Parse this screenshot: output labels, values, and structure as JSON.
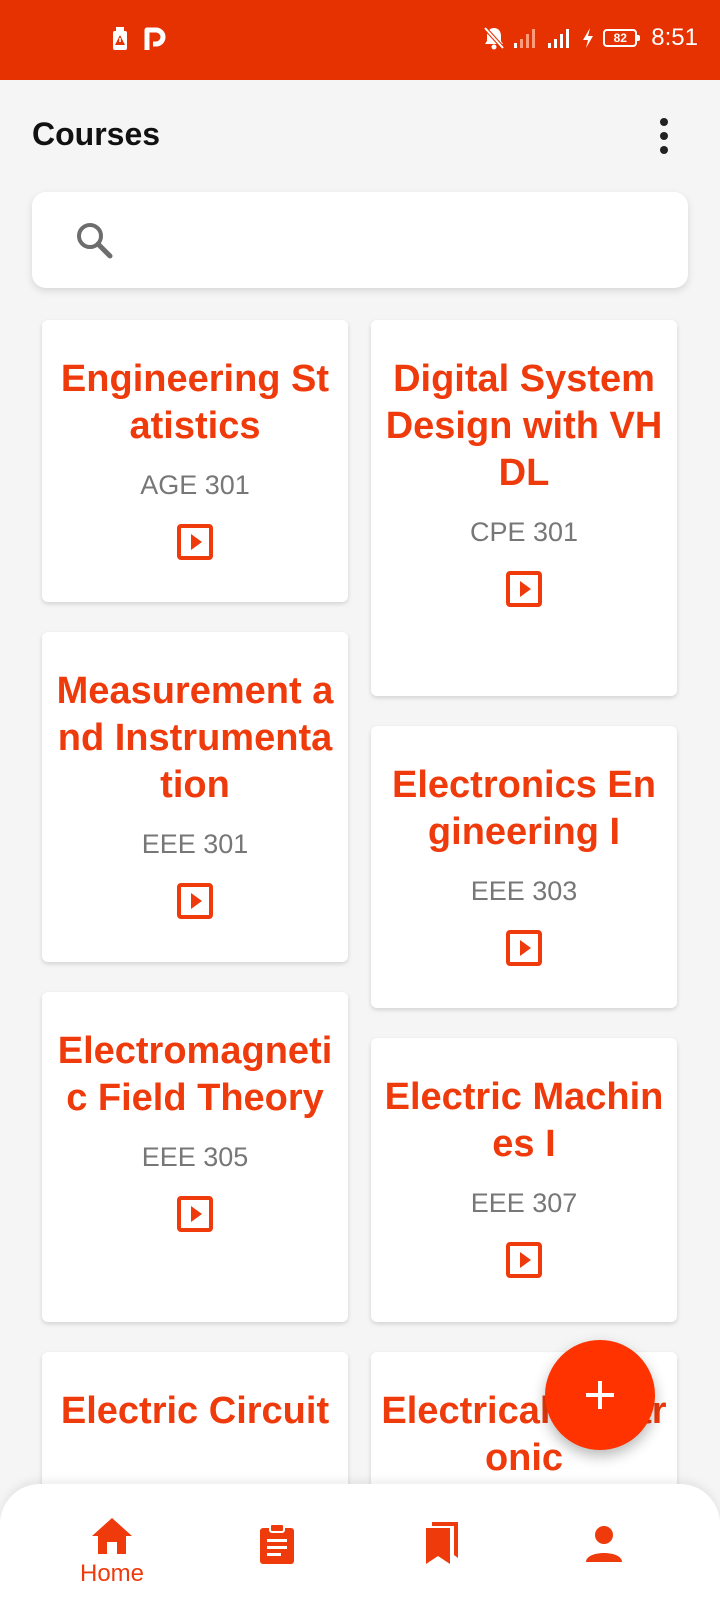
{
  "status_bar": {
    "time": "8:51",
    "battery": "82",
    "icons": [
      "gallery-alert-icon",
      "p-app-icon",
      "bell-off-icon",
      "signal-icon",
      "signal-icon",
      "charging-icon",
      "battery-icon"
    ]
  },
  "header": {
    "title": "Courses",
    "menu_icon": "more-vert-icon"
  },
  "search": {
    "placeholder": "",
    "value": "",
    "icon": "search-icon"
  },
  "courses": [
    {
      "title": "Engineering Statistics",
      "code": "AGE 301"
    },
    {
      "title": "Digital System Design with VHDL",
      "code": "CPE 301"
    },
    {
      "title": "Measurement and Instrumentation",
      "code": "EEE 301"
    },
    {
      "title": "Electronics Engineering I",
      "code": "EEE 303"
    },
    {
      "title": "Electromagnetic Field Theory",
      "code": "EEE 305"
    },
    {
      "title": "Electric Machines I",
      "code": "EEE 307"
    },
    {
      "title": "Electric Circuit",
      "code": ""
    },
    {
      "title": "Electrical Electronic",
      "code": ""
    }
  ],
  "fab": {
    "icon": "add-icon"
  },
  "bottom_nav": {
    "items": [
      {
        "label": "Home",
        "icon": "home-icon",
        "active": true
      },
      {
        "label": "",
        "icon": "assignment-icon",
        "active": false
      },
      {
        "label": "",
        "icon": "bookmarks-icon",
        "active": false
      },
      {
        "label": "",
        "icon": "person-icon",
        "active": false
      }
    ]
  },
  "colors": {
    "accent": "#e63200",
    "title_text": "#ef3a0c",
    "code_text": "#777777",
    "background": "#f5f5f5"
  }
}
